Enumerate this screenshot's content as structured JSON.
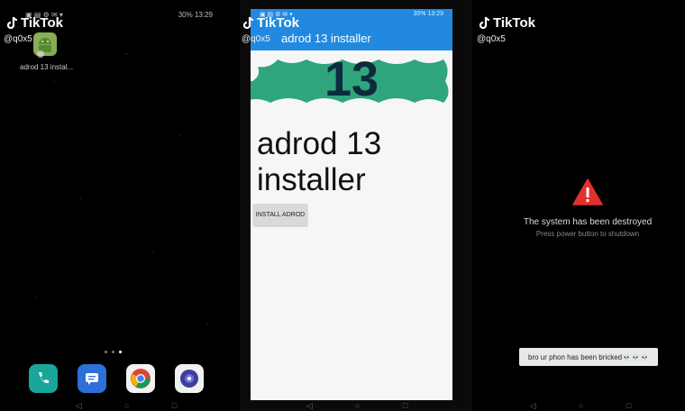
{
  "watermark": {
    "brand": "TikTok",
    "handle": "@q0x5"
  },
  "left_panel": {
    "status": {
      "time": "13:29",
      "battery": "30%"
    },
    "app_label": "adrod 13 instal...",
    "dock": [
      "phone-app",
      "messages-app",
      "chrome-app",
      "camera-app"
    ]
  },
  "mid_panel": {
    "status": {
      "time": "13:29",
      "battery": "30%"
    },
    "appbar_title": "adrod 13 installer",
    "badge_number": "13",
    "heading": "adrod 13 installer",
    "install_button": "INSTALL ADROD",
    "colors": {
      "appbar": "#2189e0",
      "badge": "#2fa57b"
    }
  },
  "right_panel": {
    "title": "The system has been destroyed",
    "subtitle": "Press power button to shutdown",
    "caption": "bro ur phon has been bricked💀💀💀",
    "colors": {
      "warning": "#e2302c"
    }
  }
}
